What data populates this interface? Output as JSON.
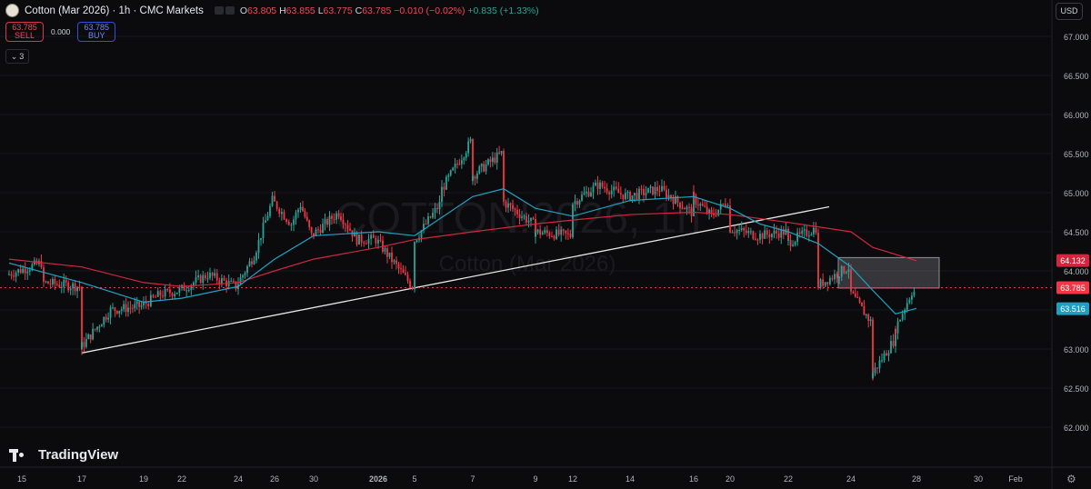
{
  "header": {
    "title": "Cotton (Mar 2026) · 1h · CMC Markets",
    "ohlc": [
      {
        "k": "O",
        "v": "63.805"
      },
      {
        "k": "H",
        "v": "63.855"
      },
      {
        "k": "L",
        "v": "63.775"
      },
      {
        "k": "C",
        "v": "63.785"
      },
      {
        "k": "",
        "v": "−0.010 (−0.02%)"
      }
    ],
    "change_green": "+0.835 (+1.33%)",
    "sell_price": "63.785",
    "sell_label": "SELL",
    "spread": "0.000",
    "buy_price": "63.785",
    "buy_label": "BUY",
    "indicators_count": "3",
    "currency": "USD"
  },
  "branding": {
    "logo_text": "TradingView"
  },
  "icons": {
    "settings": "gear-icon",
    "collapse": "chevron-down-icon",
    "symbol": "cotton-logo-icon"
  },
  "colors": {
    "background": "#0b0b0d",
    "up": "#26a69a",
    "down": "#f23645",
    "sma_fast": "#1fa4c4",
    "sma_slow": "#d2263f",
    "trendline": "#e6e6e6",
    "current_price": "#f23645",
    "ma_tag": "#1e9ec1"
  },
  "chart_data": {
    "type": "candlestick",
    "symbol": "Cotton (Mar 2026)",
    "interval": "1h",
    "watermark_main": "COTTON!2026, 1h",
    "watermark_sub": "Cotton (Mar 2026)",
    "ylim": [
      61.8,
      67.15
    ],
    "y_ticks": [
      "67.000",
      "66.500",
      "66.000",
      "65.500",
      "65.000",
      "64.500",
      "64.000",
      "63.500",
      "63.000",
      "62.500",
      "62.000"
    ],
    "x_ticks": [
      "15",
      "17",
      "19",
      "22",
      "24",
      "26",
      "30",
      "2026",
      "5",
      "7",
      "9",
      "12",
      "14",
      "16",
      "20",
      "22",
      "24",
      "28",
      "30",
      "Feb"
    ],
    "price_tags": [
      {
        "label": "64.132",
        "value": 64.132,
        "color": "#d2263f"
      },
      {
        "label": "63.785",
        "value": 63.785,
        "color": "#f23645"
      },
      {
        "label": "63.516",
        "value": 63.516,
        "color": "#1e9ec1"
      }
    ],
    "current_price": 63.785,
    "trendline": {
      "from": {
        "x": "17",
        "y": 62.95
      },
      "to": {
        "x": "29",
        "y": 64.82
      }
    },
    "supply_zone": {
      "x_from": "27",
      "x_to": "29",
      "y_from": 63.78,
      "y_to": 64.17
    },
    "price_path": [
      {
        "t": "Dec 15",
        "p": 63.95
      },
      {
        "t": "Dec 16",
        "p": 64.1
      },
      {
        "t": "Dec 16",
        "p": 63.85
      },
      {
        "t": "Dec 17",
        "p": 63.8
      },
      {
        "t": "Dec 17",
        "p": 63.0
      },
      {
        "t": "Dec 18",
        "p": 63.5
      },
      {
        "t": "Dec 19",
        "p": 63.55
      },
      {
        "t": "Dec 20",
        "p": 63.7
      },
      {
        "t": "Dec 22",
        "p": 63.75
      },
      {
        "t": "Dec 23",
        "p": 63.95
      },
      {
        "t": "Dec 24",
        "p": 63.8
      },
      {
        "t": "Dec 25",
        "p": 64.2
      },
      {
        "t": "Dec 26",
        "p": 64.9
      },
      {
        "t": "Dec 27",
        "p": 64.6
      },
      {
        "t": "Dec 29",
        "p": 64.85
      },
      {
        "t": "Dec 30",
        "p": 64.45
      },
      {
        "t": "Dec 31",
        "p": 64.75
      },
      {
        "t": "Jan 1",
        "p": 64.4
      },
      {
        "t": "Jan 2",
        "p": 64.4
      },
      {
        "t": "Jan 5",
        "p": 63.8
      },
      {
        "t": "Jan 5",
        "p": 64.35
      },
      {
        "t": "Jan 6",
        "p": 64.85
      },
      {
        "t": "Jan 6",
        "p": 65.0
      },
      {
        "t": "Jan 7",
        "p": 65.65
      },
      {
        "t": "Jan 7",
        "p": 65.2
      },
      {
        "t": "Jan 8",
        "p": 65.5
      },
      {
        "t": "Jan 8",
        "p": 64.9
      },
      {
        "t": "Jan 9",
        "p": 64.6
      },
      {
        "t": "Jan 9",
        "p": 64.5
      },
      {
        "t": "Jan 12",
        "p": 64.45
      },
      {
        "t": "Jan 12",
        "p": 64.85
      },
      {
        "t": "Jan 13",
        "p": 65.1
      },
      {
        "t": "Jan 14",
        "p": 64.95
      },
      {
        "t": "Jan 15",
        "p": 65.05
      },
      {
        "t": "Jan 16",
        "p": 64.75
      },
      {
        "t": "Jan 16",
        "p": 64.95
      },
      {
        "t": "Jan 19",
        "p": 64.7
      },
      {
        "t": "Jan 20",
        "p": 64.9
      },
      {
        "t": "Jan 20",
        "p": 64.55
      },
      {
        "t": "Jan 21",
        "p": 64.45
      },
      {
        "t": "Jan 22",
        "p": 64.5
      },
      {
        "t": "Jan 22",
        "p": 64.35
      },
      {
        "t": "Jan 23",
        "p": 64.55
      },
      {
        "t": "Jan 23",
        "p": 63.8
      },
      {
        "t": "Jan 24",
        "p": 64.05
      },
      {
        "t": "Jan 24",
        "p": 63.75
      },
      {
        "t": "Jan 26",
        "p": 63.35
      },
      {
        "t": "Jan 26",
        "p": 62.65
      },
      {
        "t": "Jan 27",
        "p": 63.1
      },
      {
        "t": "Jan 27",
        "p": 63.2
      },
      {
        "t": "Jan 28",
        "p": 63.8
      }
    ],
    "sma_fast_path": [
      {
        "t": "Dec 15",
        "p": 64.1
      },
      {
        "t": "Dec 17",
        "p": 63.85
      },
      {
        "t": "Dec 19",
        "p": 63.6
      },
      {
        "t": "Dec 22",
        "p": 63.65
      },
      {
        "t": "Dec 24",
        "p": 63.8
      },
      {
        "t": "Dec 26",
        "p": 64.15
      },
      {
        "t": "Dec 30",
        "p": 64.45
      },
      {
        "t": "Jan 2",
        "p": 64.5
      },
      {
        "t": "Jan 5",
        "p": 64.45
      },
      {
        "t": "Jan 7",
        "p": 64.95
      },
      {
        "t": "Jan 8",
        "p": 65.05
      },
      {
        "t": "Jan 9",
        "p": 64.8
      },
      {
        "t": "Jan 12",
        "p": 64.7
      },
      {
        "t": "Jan 14",
        "p": 64.9
      },
      {
        "t": "Jan 16",
        "p": 64.95
      },
      {
        "t": "Jan 20",
        "p": 64.8
      },
      {
        "t": "Jan 21",
        "p": 64.6
      },
      {
        "t": "Jan 22",
        "p": 64.5
      },
      {
        "t": "Jan 23",
        "p": 64.35
      },
      {
        "t": "Jan 24",
        "p": 64.05
      },
      {
        "t": "Jan 26",
        "p": 63.75
      },
      {
        "t": "Jan 27",
        "p": 63.45
      },
      {
        "t": "Jan 28",
        "p": 63.52
      }
    ],
    "sma_slow_path": [
      {
        "t": "Dec 15",
        "p": 64.15
      },
      {
        "t": "Dec 17",
        "p": 64.05
      },
      {
        "t": "Dec 19",
        "p": 63.85
      },
      {
        "t": "Dec 22",
        "p": 63.8
      },
      {
        "t": "Dec 24",
        "p": 63.85
      },
      {
        "t": "Dec 26",
        "p": 64.0
      },
      {
        "t": "Dec 30",
        "p": 64.15
      },
      {
        "t": "Jan 2",
        "p": 64.3
      },
      {
        "t": "Jan 5",
        "p": 64.4
      },
      {
        "t": "Jan 7",
        "p": 64.5
      },
      {
        "t": "Jan 9",
        "p": 64.6
      },
      {
        "t": "Jan 12",
        "p": 64.65
      },
      {
        "t": "Jan 14",
        "p": 64.72
      },
      {
        "t": "Jan 16",
        "p": 64.75
      },
      {
        "t": "Jan 20",
        "p": 64.72
      },
      {
        "t": "Jan 22",
        "p": 64.62
      },
      {
        "t": "Jan 24",
        "p": 64.5
      },
      {
        "t": "Jan 26",
        "p": 64.3
      },
      {
        "t": "Jan 28",
        "p": 64.13
      }
    ]
  }
}
